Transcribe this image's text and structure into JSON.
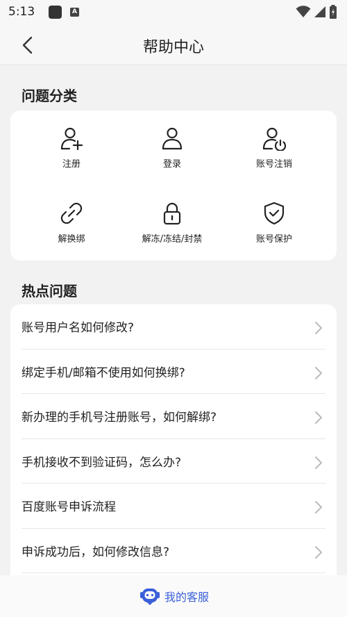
{
  "status_bar": {
    "time": "5:13",
    "a_icon_text": "A"
  },
  "header": {
    "title": "帮助中心",
    "back_icon": "chevron-left-icon"
  },
  "categories": {
    "title": "问题分类",
    "items": [
      {
        "label": "注册",
        "icon": "user-add-icon"
      },
      {
        "label": "登录",
        "icon": "user-icon"
      },
      {
        "label": "账号注销",
        "icon": "user-power-icon"
      },
      {
        "label": "解换绑",
        "icon": "unlink-icon"
      },
      {
        "label": "解冻/冻结/封禁",
        "icon": "lock-icon"
      },
      {
        "label": "账号保护",
        "icon": "shield-check-icon"
      }
    ]
  },
  "hot": {
    "title": "热点问题",
    "items": [
      "账号用户名如何修改?",
      "绑定手机/邮箱不使用如何换绑?",
      "新办理的手机号注册账号，如何解绑?",
      "手机接收不到验证码，怎么办?",
      "百度账号申诉流程",
      "申诉成功后，如何修改信息?"
    ]
  },
  "bottom": {
    "service_label": "我的客服",
    "icon": "robot-service-icon",
    "accent": "#3a5fd9"
  }
}
